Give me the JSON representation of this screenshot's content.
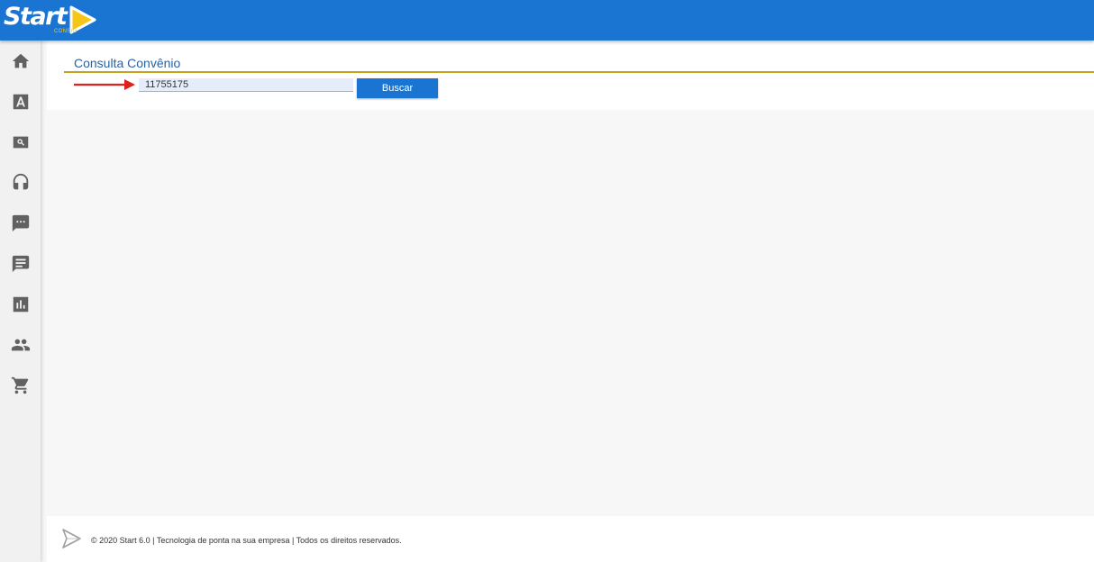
{
  "brand": {
    "name": "Start",
    "tagline": "CONSIG",
    "primary_color": "#1a75d2",
    "accent_color": "#f5c518"
  },
  "sidebar": {
    "items": [
      {
        "icon": "home-icon"
      },
      {
        "icon": "font-icon"
      },
      {
        "icon": "search-icon"
      },
      {
        "icon": "headset-icon"
      },
      {
        "icon": "chat-icon"
      },
      {
        "icon": "message-icon"
      },
      {
        "icon": "chart-icon"
      },
      {
        "icon": "people-icon"
      },
      {
        "icon": "cart-icon"
      }
    ]
  },
  "main": {
    "title": "Consulta Convênio",
    "search": {
      "value": "11755175",
      "placeholder": ""
    },
    "search_button_label": "Buscar"
  },
  "footer": {
    "text": "© 2020 Start 6.0 | Tecnologia de ponta na sua empresa | Todos os direitos reservados."
  }
}
